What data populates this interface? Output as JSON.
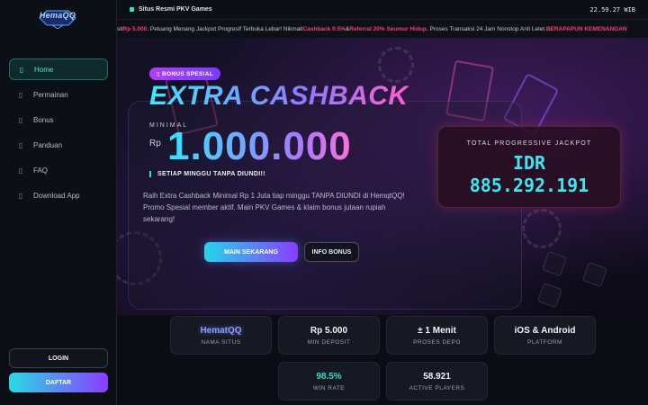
{
  "sidebar": {
    "logo": "HemaQQ",
    "items": [
      {
        "label": "Home",
        "icon": "home-icon",
        "glyph": "▯"
      },
      {
        "label": "Permainan",
        "icon": "games-icon",
        "glyph": "▯"
      },
      {
        "label": "Bonus",
        "icon": "gift-icon",
        "glyph": "▯"
      },
      {
        "label": "Panduan",
        "icon": "book-icon",
        "glyph": "▯"
      },
      {
        "label": "FAQ",
        "icon": "question-icon",
        "glyph": "▯"
      },
      {
        "label": "Download App",
        "icon": "download-icon",
        "glyph": "▯"
      }
    ],
    "login_label": "LOGIN",
    "register_label": "DAFTAR"
  },
  "topbar": {
    "site_label": "Situs Resmi PKV Games",
    "clock": "22.59.27 WIB"
  },
  "ticker": {
    "p1": "sit ",
    "h1": "Rp 5.000",
    "p2": ". Peluang Menang Jackpot Progresif Terbuka Lebar! Nikmati ",
    "h2": "Cashback 0.5%",
    "p3": " & ",
    "h3": "Referral 20% Seumur Hidup",
    "p4": ". Proses Transaksi 24 Jam Nonstop Anti Lelet. ",
    "h4": "BERAPAPUN KEMENANGAN"
  },
  "hero": {
    "badge": "▯ BONUS SPESIAL",
    "title": "EXTRA CASHBACK",
    "minimal_label": "MINIMAL",
    "currency": "Rp",
    "amount": "1.000.000",
    "subline": "SETIAP MINGGU TANPA DIUNDI!!",
    "description": "Raih Extra Cashback Minimal Rp 1 Juta tiap minggu TANPA DIUNDI di HemqtQQ! Promo Spesial member aktif. Main PKV Games & klaim bonus jutaan rupiah sekarang!",
    "primary_button": "MAIN SEKARANG",
    "secondary_button": "INFO BONUS"
  },
  "jackpot": {
    "label": "TOTAL PROGRESSIVE JACKPOT",
    "currency": "IDR",
    "value": "885.292.191"
  },
  "stats": [
    {
      "value": "HematQQ",
      "label": "NAMA SITUS"
    },
    {
      "value": "Rp 5.000",
      "label": "MIN DEPOSIT"
    },
    {
      "value": "± 1 Menit",
      "label": "PROSES DEPO"
    },
    {
      "value": "iOS & Android",
      "label": "PLATFORM"
    },
    {
      "value": "98.5%",
      "label": "WIN RATE"
    },
    {
      "value": "58.921",
      "label": "ACTIVE PLAYERS"
    }
  ],
  "colors": {
    "accent_teal": "#2fe0c9",
    "accent_purple": "#8a3cff",
    "accent_pink": "#ff3d71",
    "background": "#0b0d14"
  }
}
